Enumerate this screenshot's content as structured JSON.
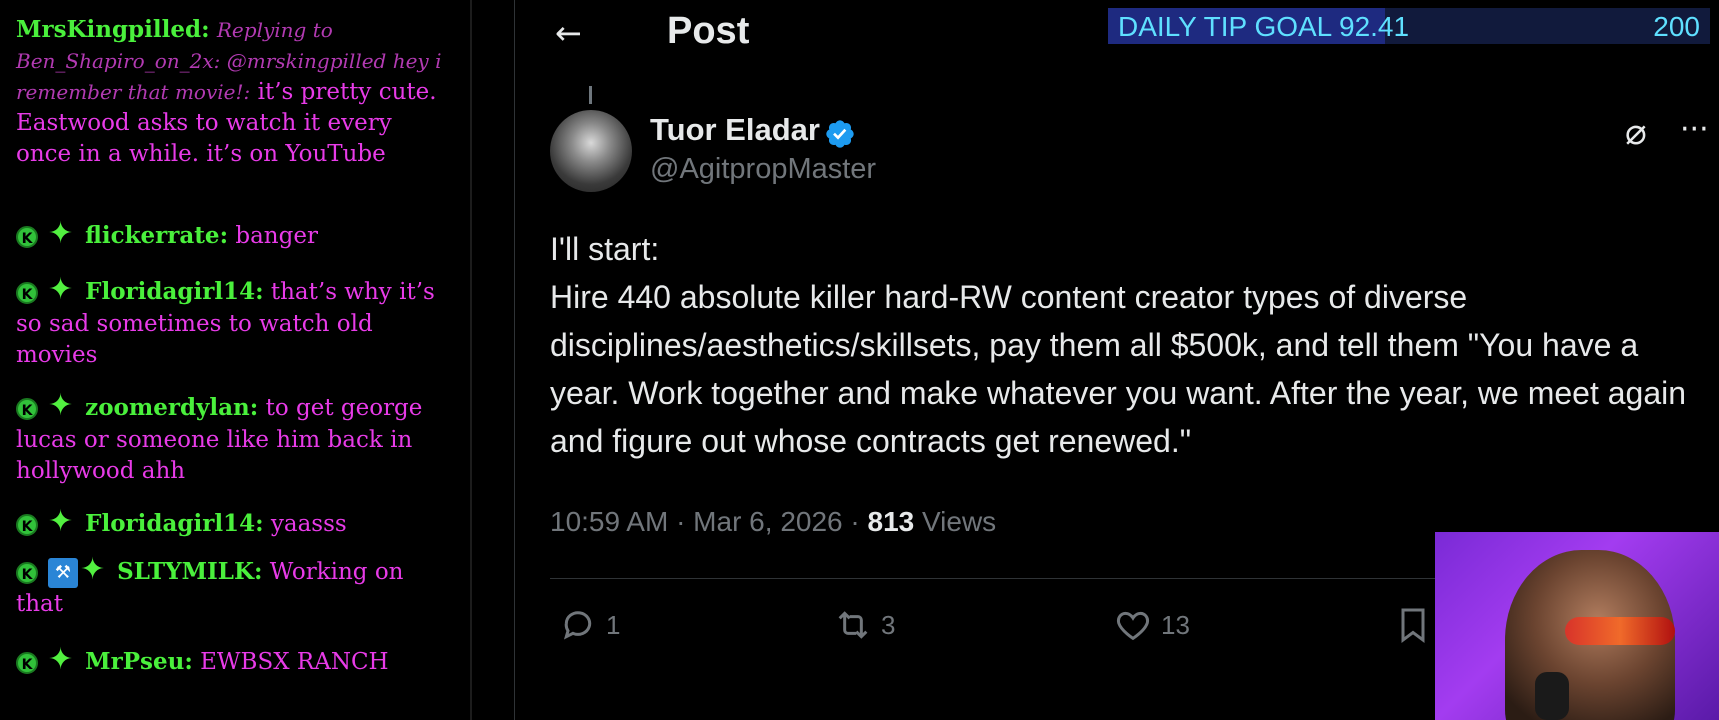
{
  "chat": {
    "messages": [
      {
        "user": "MrsKingpilled:",
        "reply": "Replying to Ben_Shapiro_on_2x: @mrskingpilled hey i remember that movie!:",
        "text": "it’s pretty cute. Eastwood asks to watch it every once in a while. it’s on YouTube"
      },
      {
        "user": "flickerrate:",
        "text": "banger"
      },
      {
        "user": "Floridagirl14:",
        "text": "that’s why it’s so sad sometimes to watch old movies"
      },
      {
        "user": "zoomerdylan:",
        "text": "to get george lucas or someone like him back in hollywood ahh"
      },
      {
        "user": "Floridagirl14:",
        "text": "yaasss"
      },
      {
        "user": "SLTYMILK:",
        "text": "Working on that"
      },
      {
        "user": "MrPseu:",
        "text": "EWBSX RANCH"
      }
    ],
    "colors": {
      "username": "#4af03c",
      "message": "#e83be8"
    }
  },
  "post": {
    "title": "Post",
    "back_icon": "arrow-left-icon",
    "author": {
      "name": "Tuor Eladar",
      "handle": "@AgitpropMaster",
      "verified": true
    },
    "body": [
      "I'll start:",
      "Hire 440 absolute killer hard-RW content creator types of diverse disciplines/aesthetics/skillsets, pay them all $500k, and tell them \"You have a year. Work together and make whatever you want. After the year, we meet again and figure out whose contracts get renewed.\""
    ],
    "meta": {
      "time": "10:59 AM · Mar 6, 2026 · ",
      "views_count": "813",
      "views_label": " Views"
    },
    "actions": {
      "replies": "1",
      "reposts": "3",
      "likes": "13"
    }
  },
  "tip_goal": {
    "label": "DAILY TIP GOAL 92.41",
    "current": 92.41,
    "goal": "200",
    "fraction": 0.46
  }
}
